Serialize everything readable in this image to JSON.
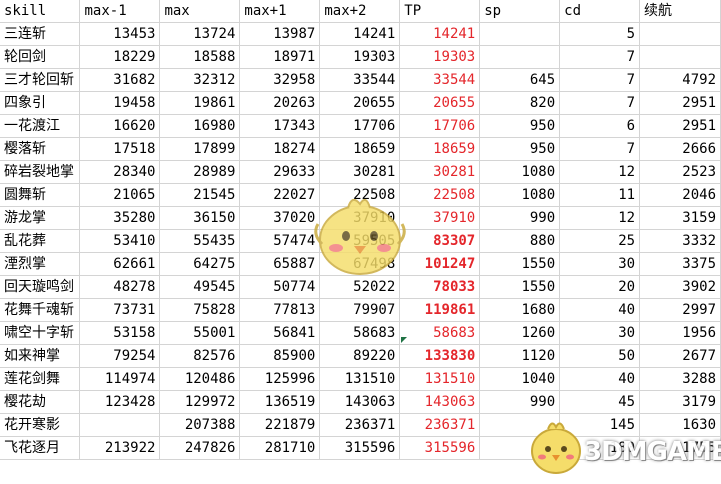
{
  "colors": {
    "tp_text": "#e4262b",
    "grid": "#d4d4d4",
    "selection": "#1f7244"
  },
  "header": [
    "skill",
    "max-1",
    "max",
    "max+1",
    "max+2",
    "TP",
    "sp",
    "cd",
    "续航"
  ],
  "rows": [
    {
      "name": "三连斩",
      "max_minus_1": "13453",
      "max": "13724",
      "max_plus_1": "13987",
      "max_plus_2": "14241",
      "tp": "14241",
      "tp_bold": false,
      "sp": "",
      "cd": "5",
      "endurance": ""
    },
    {
      "name": "轮回剑",
      "max_minus_1": "18229",
      "max": "18588",
      "max_plus_1": "18971",
      "max_plus_2": "19303",
      "tp": "19303",
      "tp_bold": false,
      "sp": "",
      "cd": "7",
      "endurance": ""
    },
    {
      "name": "三才轮回斩",
      "max_minus_1": "31682",
      "max": "32312",
      "max_plus_1": "32958",
      "max_plus_2": "33544",
      "tp": "33544",
      "tp_bold": false,
      "sp": "645",
      "cd": "7",
      "endurance": "4792"
    },
    {
      "name": "四象引",
      "max_minus_1": "19458",
      "max": "19861",
      "max_plus_1": "20263",
      "max_plus_2": "20655",
      "tp": "20655",
      "tp_bold": false,
      "sp": "820",
      "cd": "7",
      "endurance": "2951"
    },
    {
      "name": "一花渡江",
      "max_minus_1": "16620",
      "max": "16980",
      "max_plus_1": "17343",
      "max_plus_2": "17706",
      "tp": "17706",
      "tp_bold": false,
      "sp": "950",
      "cd": "6",
      "endurance": "2951"
    },
    {
      "name": "樱落斩",
      "max_minus_1": "17518",
      "max": "17899",
      "max_plus_1": "18274",
      "max_plus_2": "18659",
      "tp": "18659",
      "tp_bold": false,
      "sp": "950",
      "cd": "7",
      "endurance": "2666"
    },
    {
      "name": "碎岩裂地掌",
      "max_minus_1": "28340",
      "max": "28989",
      "max_plus_1": "29633",
      "max_plus_2": "30281",
      "tp": "30281",
      "tp_bold": false,
      "sp": "1080",
      "cd": "12",
      "endurance": "2523"
    },
    {
      "name": "圆舞斩",
      "max_minus_1": "21065",
      "max": "21545",
      "max_plus_1": "22027",
      "max_plus_2": "22508",
      "tp": "22508",
      "tp_bold": false,
      "sp": "1080",
      "cd": "11",
      "endurance": "2046"
    },
    {
      "name": "游龙掌",
      "max_minus_1": "35280",
      "max": "36150",
      "max_plus_1": "37020",
      "max_plus_2": "37910",
      "tp": "37910",
      "tp_bold": false,
      "sp": "990",
      "cd": "12",
      "endurance": "3159"
    },
    {
      "name": "乱花葬",
      "max_minus_1": "53410",
      "max": "55435",
      "max_plus_1": "57474",
      "max_plus_2": "59505",
      "tp": "83307",
      "tp_bold": true,
      "sp": "880",
      "cd": "25",
      "endurance": "3332"
    },
    {
      "name": "湮烈掌",
      "max_minus_1": "62661",
      "max": "64275",
      "max_plus_1": "65887",
      "max_plus_2": "67498",
      "tp": "101247",
      "tp_bold": true,
      "sp": "1550",
      "cd": "30",
      "endurance": "3375"
    },
    {
      "name": "回天璇鸣剑",
      "max_minus_1": "48278",
      "max": "49545",
      "max_plus_1": "50774",
      "max_plus_2": "52022",
      "tp": "78033",
      "tp_bold": true,
      "sp": "1550",
      "cd": "20",
      "endurance": "3902"
    },
    {
      "name": "花舞千魂斩",
      "max_minus_1": "73731",
      "max": "75828",
      "max_plus_1": "77813",
      "max_plus_2": "79907",
      "tp": "119861",
      "tp_bold": true,
      "sp": "1680",
      "cd": "40",
      "endurance": "2997"
    },
    {
      "name": "啸空十字斩",
      "max_minus_1": "53158",
      "max": "55001",
      "max_plus_1": "56841",
      "max_plus_2": "58683",
      "tp": "58683",
      "tp_bold": false,
      "sp": "1260",
      "cd": "30",
      "endurance": "1956"
    },
    {
      "name": "如来神掌",
      "max_minus_1": "79254",
      "max": "82576",
      "max_plus_1": "85900",
      "max_plus_2": "89220",
      "tp": "133830",
      "tp_bold": true,
      "sp": "1120",
      "cd": "50",
      "endurance": "2677"
    },
    {
      "name": "莲花剑舞",
      "max_minus_1": "114974",
      "max": "120486",
      "max_plus_1": "125996",
      "max_plus_2": "131510",
      "tp": "131510",
      "tp_bold": false,
      "sp": "1040",
      "cd": "40",
      "endurance": "3288"
    },
    {
      "name": "樱花劫",
      "max_minus_1": "123428",
      "max": "129972",
      "max_plus_1": "136519",
      "max_plus_2": "143063",
      "tp": "143063",
      "tp_bold": false,
      "sp": "990",
      "cd": "45",
      "endurance": "3179"
    },
    {
      "name": "花开寒影",
      "max_minus_1": "",
      "max": "207388",
      "max_plus_1": "221879",
      "max_plus_2": "236371",
      "tp": "236371",
      "tp_bold": false,
      "sp": "",
      "cd": "145",
      "endurance": "1630"
    },
    {
      "name": "飞花逐月",
      "max_minus_1": "213922",
      "max": "247826",
      "max_plus_1": "281710",
      "max_plus_2": "315596",
      "tp": "315596",
      "tp_bold": false,
      "sp": "",
      "cd": "180",
      "endurance": "1755"
    }
  ],
  "watermark": {
    "logo_text": "3DMGAME",
    "mascot_icon": "chick-mascot-icon"
  }
}
